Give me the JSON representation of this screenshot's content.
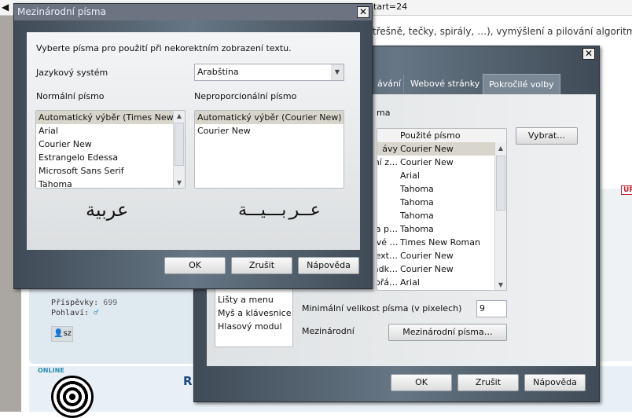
{
  "browser": {
    "url_fragment": "tart=24",
    "page_text": "třešně, tečky, spirály, …), vymýšlení a pilování algoritm",
    "nav_icon": "back-icon"
  },
  "forum": {
    "posts_label": "Příspěvky:",
    "posts_value": "699",
    "gender_label": "Pohlaví:",
    "gender_icon": "male-icon",
    "pm_button": "sz",
    "online": "ONLINE",
    "post_title_initial": "R",
    "badge": "UP"
  },
  "back_dialog": {
    "tabs": [
      "ávání",
      "Webové stránky",
      "Pokročilé volby"
    ],
    "section_label": "ma",
    "table_header": "Použité písmo",
    "rows": [
      [
        "ávy",
        "Courier New"
      ],
      [
        "ní z…",
        "Courier New"
      ],
      [
        "",
        "Arial"
      ],
      [
        "",
        "Tahoma"
      ],
      [
        "",
        "Tahoma"
      ],
      [
        "",
        "Tahoma"
      ],
      [
        "a p…",
        "Tahoma"
      ],
      [
        "ové …",
        "Times New Roman"
      ],
      [
        "ext…",
        "Courier New"
      ],
      [
        "ádk…",
        "Courier New"
      ],
      [
        "ořá…",
        "Arial"
      ]
    ],
    "select_button": "Vybrat…",
    "categories": [
      "Lišty a menu",
      "Myš a klávesnice",
      "Hlasový modul"
    ],
    "min_size_label": "Minimální velikost písma (v pixelech)",
    "min_size_value": "9",
    "intl_label": "Mezinárodní",
    "intl_button": "Mezinárodní písma…",
    "ok": "OK",
    "cancel": "Zrušit",
    "help": "Nápověda"
  },
  "front_dialog": {
    "title": "Mezinárodní písma",
    "intro": "Vyberte písma pro použití při nekorektním zobrazení textu.",
    "lang_label": "Jazykový systém",
    "lang_value": "Arabština",
    "normal_label": "Normální písmo",
    "mono_label": "Neproporcionální písmo",
    "normal_fonts": [
      "Automatický výběr (Times New R…",
      "Arial",
      "Courier New",
      "Estrangelo Edessa",
      "Microsoft Sans Serif",
      "Tahoma"
    ],
    "mono_fonts": [
      "Automatický výběr (Courier New)",
      "Courier New"
    ],
    "preview_normal": "عربية",
    "preview_mono": "عـربـيـة",
    "ok": "OK",
    "cancel": "Zrušit",
    "help": "Nápověda"
  }
}
